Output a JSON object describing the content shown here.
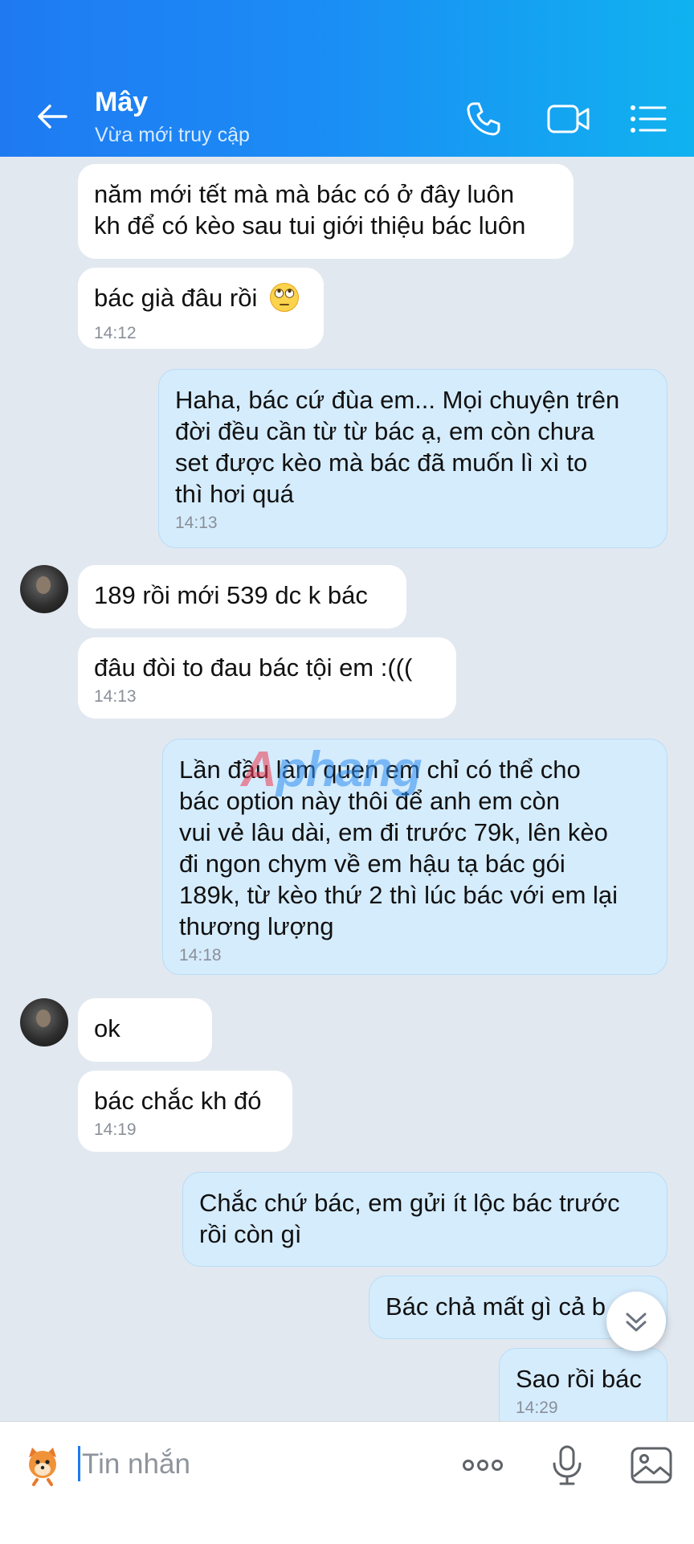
{
  "header": {
    "contact_name": "Mây",
    "status": "Vừa mới truy cập",
    "icons": [
      "back-arrow-icon",
      "phone-icon",
      "video-call-icon",
      "menu-list-icon"
    ]
  },
  "messages": [
    {
      "id": "m1",
      "from": "them",
      "text": "năm mới tết mà mà bác có ở đây luôn\nkh để có kèo sau tui giới thiệu bác luôn",
      "time": ""
    },
    {
      "id": "m2",
      "from": "them",
      "text": "bác già đâu rồi",
      "emoji": "eye-roll-emoji",
      "time": "14:12"
    },
    {
      "id": "m3",
      "from": "me",
      "text": "Haha, bác cứ đùa em... Mọi chuyện trên\nđời đều cần từ từ bác ạ, em còn chưa\nset được kèo mà bác đã muốn lì xì to\nthì hơi quá",
      "time": "14:13"
    },
    {
      "id": "m4",
      "from": "them",
      "text": "189 rồi mới 539 dc k bác",
      "time": ""
    },
    {
      "id": "m5",
      "from": "them",
      "text": "đâu đòi to đau bác tội em :(((",
      "time": "14:13"
    },
    {
      "id": "m6",
      "from": "me",
      "text": "Lần đầu làm quen em chỉ có thể cho\nbác option này thôi để anh em còn\nvui vẻ lâu dài, em đi trước 79k, lên kèo\nđi ngon chym về em hậu tạ bác gói\n189k, từ kèo thứ 2 thì lúc bác với em lại\nthương lượng",
      "time": "14:18"
    },
    {
      "id": "m7",
      "from": "them",
      "text": "ok",
      "time": ""
    },
    {
      "id": "m8",
      "from": "them",
      "text": "bác chắc kh đó",
      "time": "14:19"
    },
    {
      "id": "m9",
      "from": "me",
      "text": "Chắc chứ bác, em gửi ít lộc bác trước\nrồi còn gì",
      "time": ""
    },
    {
      "id": "m10",
      "from": "me",
      "text": "Bác chả mất gì cả b",
      "time": ""
    },
    {
      "id": "m11",
      "from": "me",
      "text": "Sao rồi bác",
      "time": "14:29"
    }
  ],
  "watermark": {
    "part_a": "A",
    "part_b": "phang"
  },
  "input": {
    "placeholder": "Tin nhắn",
    "value": ""
  },
  "colors": {
    "header_start": "#1f7af2",
    "header_end": "#10b2ef",
    "out_bubble": "#d5ecfd",
    "in_bubble": "#ffffff",
    "chat_bg": "#e2e8f0"
  }
}
